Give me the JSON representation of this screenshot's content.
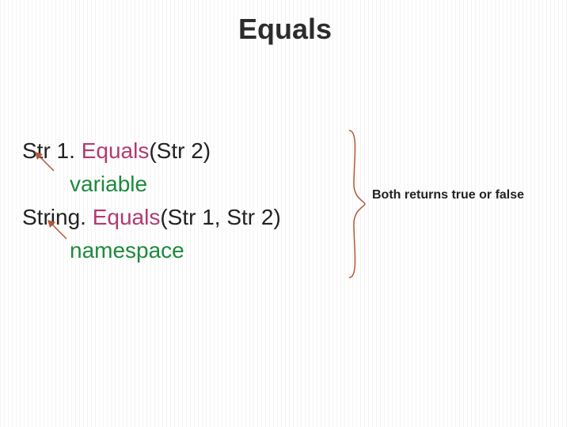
{
  "title": "Equals",
  "lines": {
    "l1a": "Str 1. ",
    "l1b": "Equals",
    "l1c": "(Str 2)",
    "l2": "variable",
    "l3a": "String. ",
    "l3b": "Equals",
    "l3c": "(Str 1, Str 2)",
    "l4": "namespace"
  },
  "side_note": "Both returns true or false"
}
